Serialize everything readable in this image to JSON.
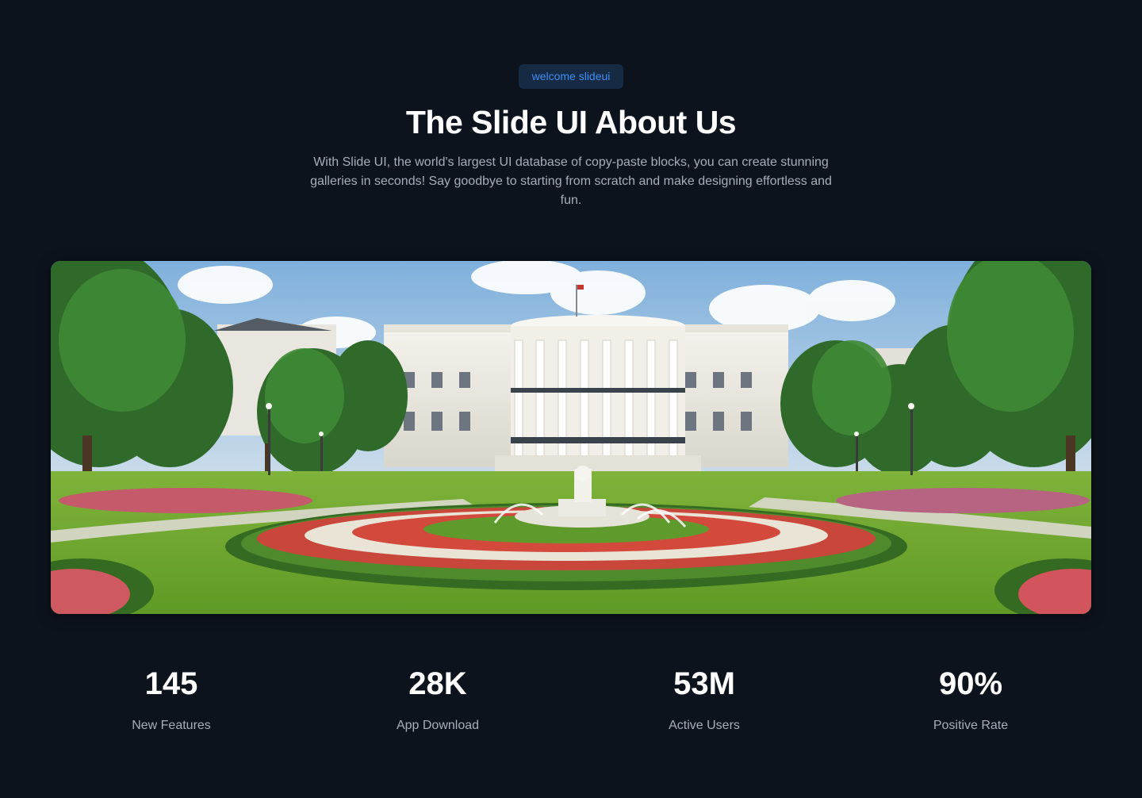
{
  "header": {
    "badge": "welcome slideui",
    "title": "The Slide UI About Us",
    "description": "With Slide UI, the world's largest UI database of copy-paste blocks, you can create stunning galleries in seconds! Say goodbye to starting from scratch and make designing effortless and fun."
  },
  "stats": [
    {
      "value": "145",
      "label": "New Features"
    },
    {
      "value": "28K",
      "label": "App Download"
    },
    {
      "value": "53M",
      "label": "Active Users"
    },
    {
      "value": "90%",
      "label": "Positive Rate"
    }
  ],
  "colors": {
    "background": "#0d131d",
    "badge_bg": "#172a44",
    "badge_text": "#3f8ef5",
    "heading": "#ffffff",
    "muted_text": "#a7aeb9"
  }
}
